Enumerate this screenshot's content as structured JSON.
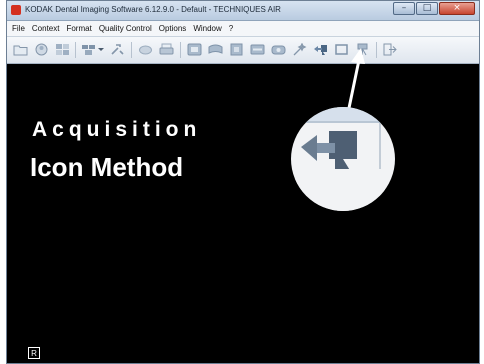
{
  "window": {
    "title": "KODAK Dental Imaging Software 6.12.9.0 - Default - TECHNIQUES AIR",
    "min_glyph": "–",
    "max_glyph": "□",
    "close_glyph": "×"
  },
  "menu": {
    "items": [
      "File",
      "Context",
      "Format",
      "Quality Control",
      "Options",
      "Window",
      "?"
    ]
  },
  "toolbar": {
    "icons": [
      "open-folder-icon",
      "patient-icon",
      "images-icon",
      "arrange-icon",
      "dropdown-arrow-icon",
      "tools-icon",
      "brush-icon",
      "print-icon",
      "intraoral-icon",
      "panoramic-icon",
      "sensor-icon",
      "scanner-icon",
      "camera-icon",
      "magic-wand-icon",
      "acquisition-icon",
      "frame-icon",
      "tripod-icon",
      "exit-icon"
    ]
  },
  "overlay": {
    "heading_line1": "Acquisition",
    "heading_line2": "Icon Method",
    "corner_label": "R"
  },
  "colors": {
    "canvas_bg": "#000000",
    "toolbar_icon": "#8da2b8",
    "close_button": "#c7452f"
  }
}
